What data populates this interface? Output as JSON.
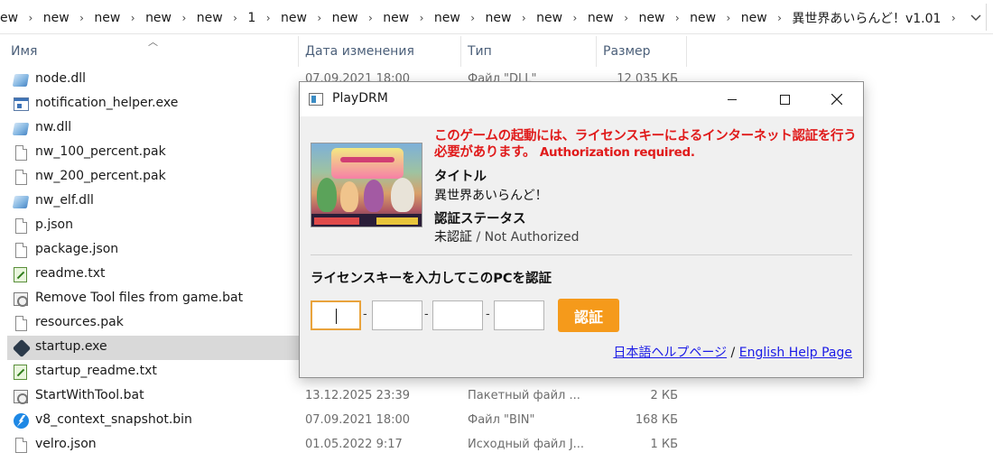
{
  "explorer": {
    "breadcrumbs": [
      "ew",
      "new",
      "new",
      "new",
      "new",
      "1",
      "new",
      "new",
      "new",
      "new",
      "new",
      "new",
      "new",
      "new",
      "new",
      "new",
      "異世界あいらんど！v1.01"
    ],
    "columns": {
      "name": "Имя",
      "date": "Дата изменения",
      "type": "Тип",
      "size": "Размер"
    },
    "files": [
      {
        "name": "node.dll",
        "icon": "dll-icon",
        "date": "07.09.2021 18:00",
        "type": "Файл \"DLL\"",
        "size": "12 035 КБ"
      },
      {
        "name": "notification_helper.exe",
        "icon": "exe-icon",
        "date": "",
        "type": "",
        "size": ""
      },
      {
        "name": "nw.dll",
        "icon": "dll-icon",
        "date": "",
        "type": "",
        "size": ""
      },
      {
        "name": "nw_100_percent.pak",
        "icon": "file-icon",
        "date": "",
        "type": "",
        "size": ""
      },
      {
        "name": "nw_200_percent.pak",
        "icon": "file-icon",
        "date": "",
        "type": "",
        "size": ""
      },
      {
        "name": "nw_elf.dll",
        "icon": "dll-icon",
        "date": "",
        "type": "",
        "size": ""
      },
      {
        "name": "p.json",
        "icon": "file-icon",
        "date": "",
        "type": "",
        "size": ""
      },
      {
        "name": "package.json",
        "icon": "file-icon",
        "date": "",
        "type": "",
        "size": ""
      },
      {
        "name": "readme.txt",
        "icon": "text-file-icon",
        "date": "",
        "type": "",
        "size": ""
      },
      {
        "name": "Remove Tool files from game.bat",
        "icon": "batch-file-icon",
        "date": "",
        "type": "",
        "size": ""
      },
      {
        "name": "resources.pak",
        "icon": "file-icon",
        "date": "",
        "type": "",
        "size": ""
      },
      {
        "name": "startup.exe",
        "icon": "game-exe-icon",
        "date": "",
        "type": "",
        "size": ""
      },
      {
        "name": "startup_readme.txt",
        "icon": "text-file-icon",
        "date": "",
        "type": "",
        "size": ""
      },
      {
        "name": "StartWithTool.bat",
        "icon": "batch-file-icon",
        "date": "13.12.2025 23:39",
        "type": "Пакетный файл ...",
        "size": "2 КБ"
      },
      {
        "name": "v8_context_snapshot.bin",
        "icon": "bin-file-icon",
        "date": "07.09.2021 18:00",
        "type": "Файл \"BIN\"",
        "size": "168 КБ"
      },
      {
        "name": "velro.json",
        "icon": "file-icon",
        "date": "01.05.2022 9:17",
        "type": "Исходный файл J...",
        "size": "1 КБ"
      }
    ]
  },
  "dialog": {
    "title": "PlayDRM",
    "requirement_jp": "このゲームの起動には、ライセンスキーによるインターネット認証を行う必要があります。",
    "requirement_en": "Authorization required.",
    "title_label": "タイトル",
    "game_title": "異世界あいらんど！",
    "status_label": "認証ステータス",
    "status_jp": "未認証",
    "status_sep": " / ",
    "status_en": "Not Authorized",
    "prompt": "ライセンスキーを入力してこのPCを認証",
    "key_fields": [
      "",
      "",
      "",
      ""
    ],
    "key_separator": "-",
    "auth_button": "認証",
    "help_jp": "日本語ヘルプページ",
    "help_sep": " / ",
    "help_en": "English Help Page",
    "accent_color": "#f59a1b",
    "warning_color": "#e01b1b"
  }
}
